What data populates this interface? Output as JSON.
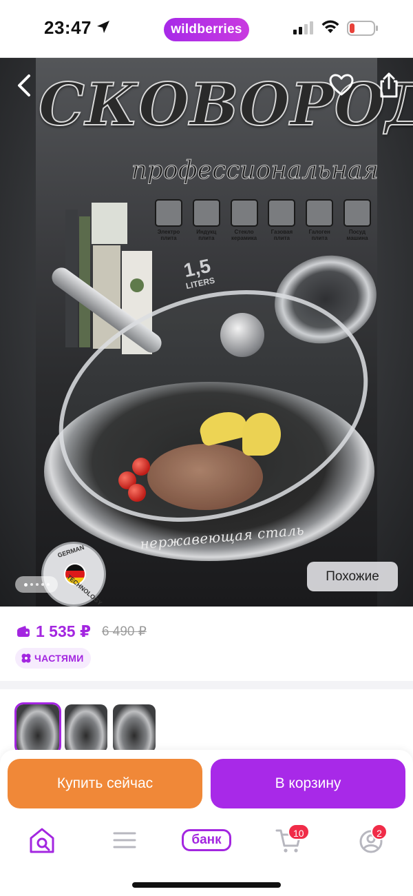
{
  "status_bar": {
    "time": "23:47",
    "brand": "wildberries",
    "icons": [
      "location-arrow-icon",
      "signal-icon",
      "wifi-icon",
      "battery-low-icon"
    ],
    "battery_color": "#e8423a"
  },
  "hero": {
    "title": "СКОВОРОДА",
    "subtitle": "профессиональная",
    "features": [
      {
        "label": "Электро плита"
      },
      {
        "label": "Индукц плита"
      },
      {
        "label": "Стекло керамика"
      },
      {
        "label": "Газовая плита"
      },
      {
        "label": "Галоген плита"
      },
      {
        "label": "Посуд машина"
      }
    ],
    "volume_number": "1,5",
    "volume_unit": "LITERS",
    "pan_text": "нержавеющая сталь",
    "badge_top": "GERMAN",
    "badge_bottom": "TECHNOLOGY",
    "similar_label": "Похожие",
    "dots_count": 5,
    "icons": [
      "back-chevron-icon",
      "heart-icon",
      "share-icon"
    ]
  },
  "price": {
    "current": "1 535 ₽",
    "old": "6 490 ₽",
    "parts_label": "ЧАСТЯМИ",
    "accent_color": "#a326e0"
  },
  "thumbnails": {
    "count": 3,
    "active_index": 0
  },
  "actions": {
    "buy_now": "Купить сейчас",
    "add_to_cart": "В корзину",
    "buy_color": "#f08838",
    "cart_color": "#a829e8"
  },
  "bottom_nav": {
    "items": [
      {
        "name": "home-search",
        "icon": "home-search-icon"
      },
      {
        "name": "catalog",
        "icon": "menu-icon"
      },
      {
        "name": "bank",
        "label": "банк"
      },
      {
        "name": "cart",
        "icon": "cart-icon",
        "badge": "10"
      },
      {
        "name": "profile",
        "icon": "profile-icon",
        "badge": "2"
      }
    ],
    "badge_color": "#f02c48"
  }
}
